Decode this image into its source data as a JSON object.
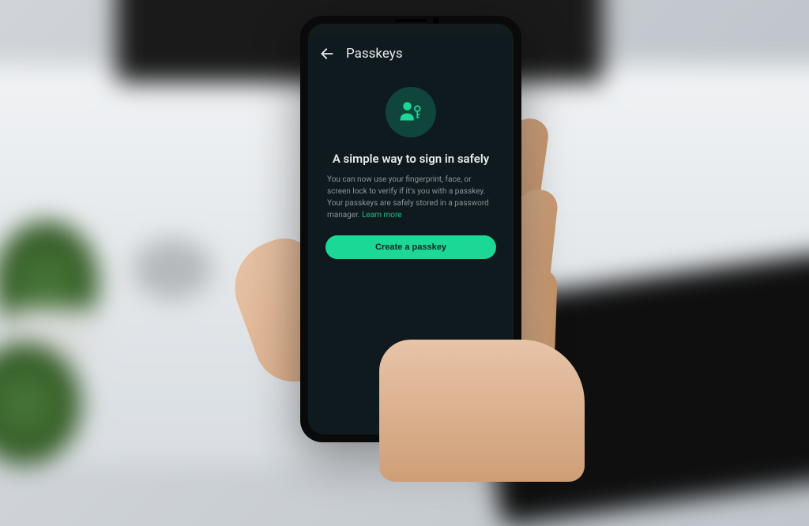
{
  "header": {
    "title": "Passkeys"
  },
  "content": {
    "heading": "A simple way to sign in safely",
    "body": "You can now use your fingerprint, face, or screen lock to verify if it's you with a passkey. Your passkeys are safely stored in a password manager.",
    "learn_more": "Learn more",
    "cta": "Create a passkey"
  },
  "icons": {
    "back": "arrow-left",
    "hero": "passkey-person"
  },
  "colors": {
    "accent": "#1bd896",
    "screen_bg": "#0e1a1d",
    "icon_bg": "#10453c"
  }
}
